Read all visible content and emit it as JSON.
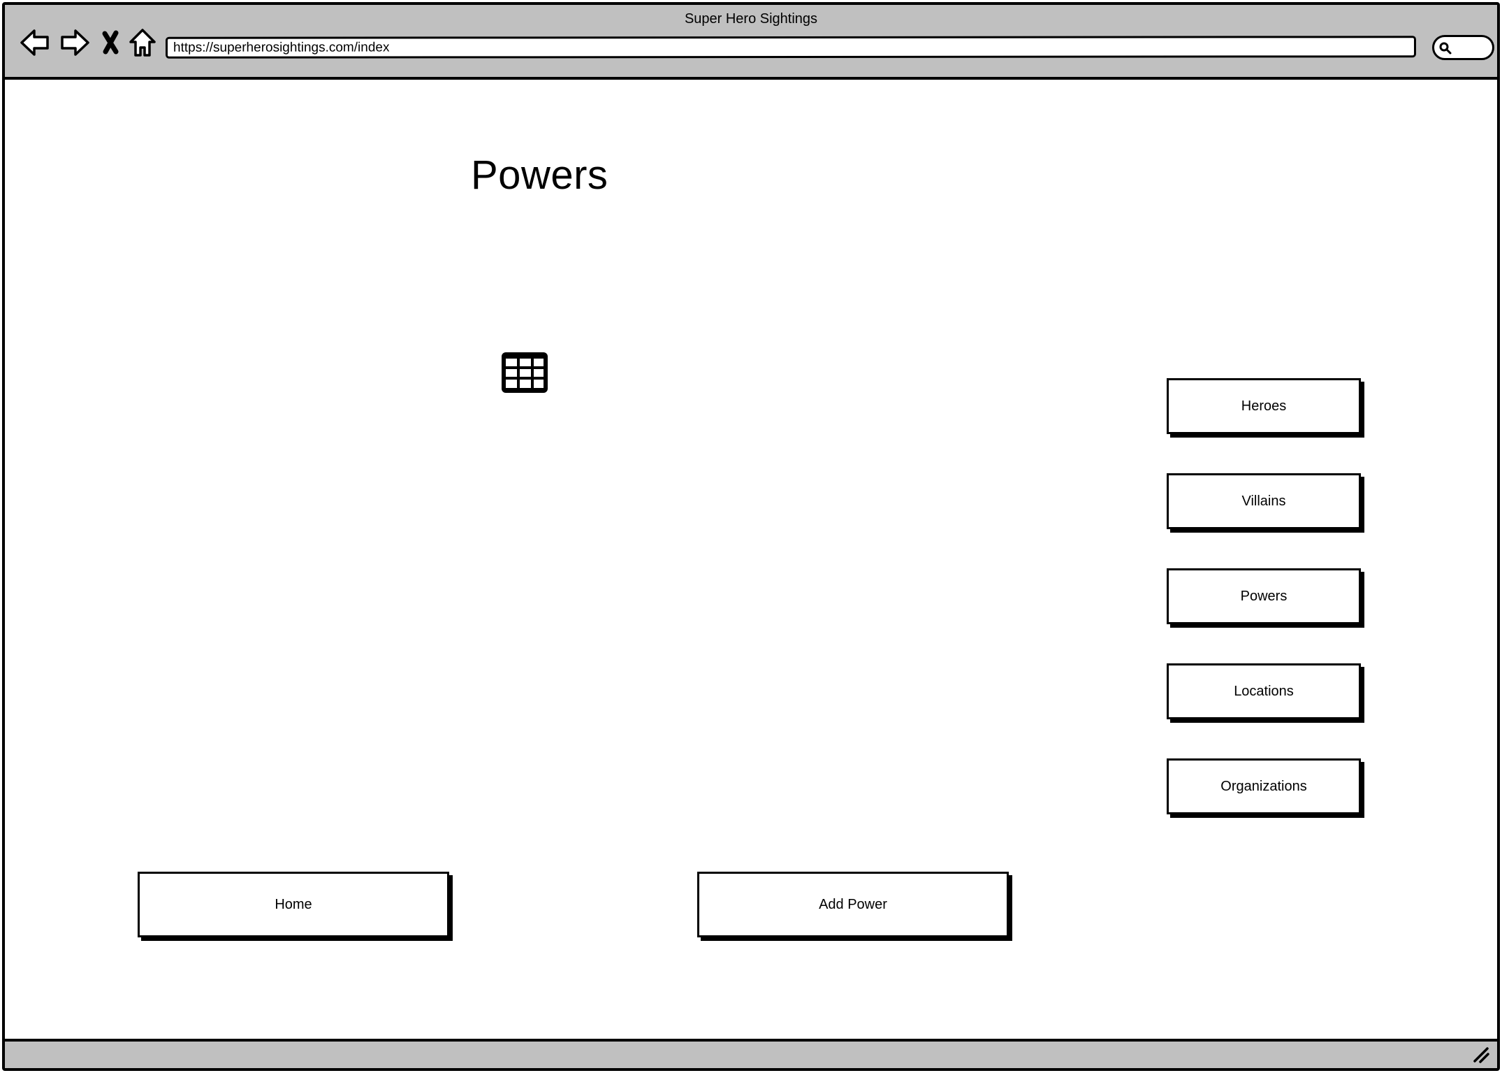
{
  "window": {
    "title": "Super Hero Sightings"
  },
  "toolbar": {
    "icons": [
      "back-arrow-icon",
      "forward-arrow-icon",
      "stop-icon",
      "home-icon",
      "search-icon"
    ],
    "url": "https://superherosightings.com/index"
  },
  "main": {
    "heading": "Powers",
    "table_placeholder_icon": "table-icon",
    "home_button": "Home",
    "add_button": "Add Power"
  },
  "sidebar": {
    "items": [
      {
        "label": "Heroes"
      },
      {
        "label": "Villains"
      },
      {
        "label": "Powers"
      },
      {
        "label": "Locations"
      },
      {
        "label": "Organizations"
      }
    ]
  },
  "statusbar": {
    "grip_icon": "resize-grip-icon"
  }
}
